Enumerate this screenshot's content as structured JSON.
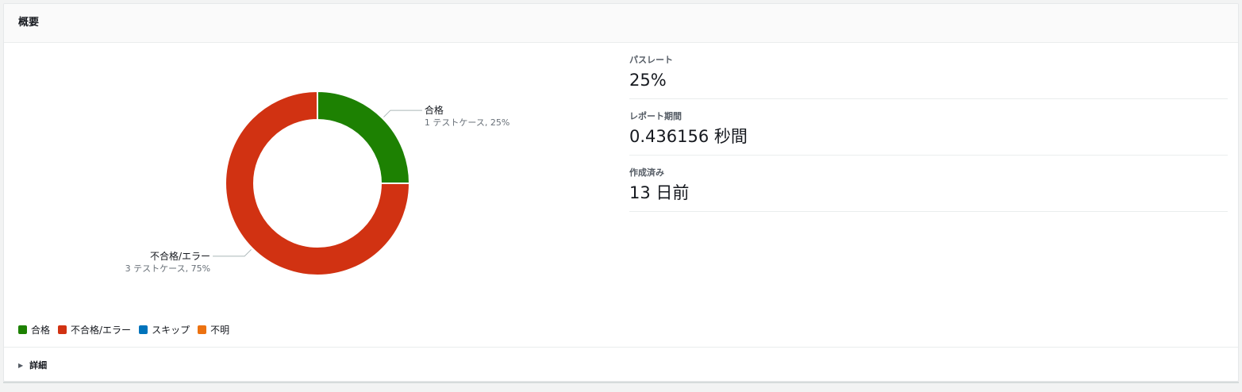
{
  "panel": {
    "title": "概要",
    "details_label": "詳細"
  },
  "metrics": [
    {
      "label": "パスレート",
      "value": "25%"
    },
    {
      "label": "レポート期間",
      "value": "0.436156 秒間"
    },
    {
      "label": "作成済み",
      "value": "13 日前"
    }
  ],
  "legend": [
    {
      "label": "合格",
      "color": "#1d8102"
    },
    {
      "label": "不合格/エラー",
      "color": "#d13212"
    },
    {
      "label": "スキップ",
      "color": "#0073bb"
    },
    {
      "label": "不明",
      "color": "#ec7211"
    }
  ],
  "chart_data": {
    "type": "pie",
    "donut": true,
    "categories": [
      "合格",
      "不合格/エラー"
    ],
    "values": [
      25,
      75
    ],
    "counts": [
      1,
      3
    ],
    "colors": [
      "#1d8102",
      "#d13212"
    ],
    "slice_labels": [
      {
        "name": "合格",
        "detail": "1 テストケース, 25%"
      },
      {
        "name": "不合格/エラー",
        "detail": "3 テストケース, 75%"
      }
    ]
  }
}
